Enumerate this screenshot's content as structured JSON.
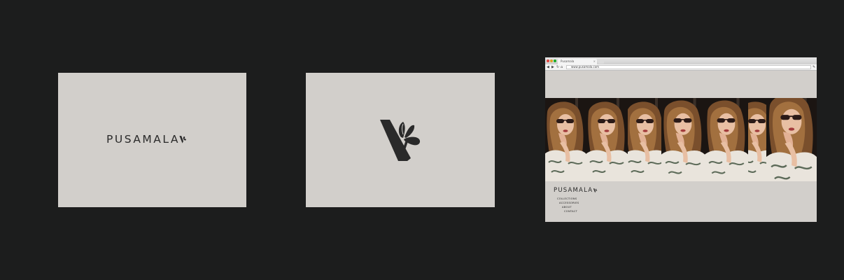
{
  "brand": {
    "wordmark": "PUSAMALA"
  },
  "colors": {
    "background": "#1c1d1d",
    "card": "#d2cfcb",
    "ink": "#2a2a2a"
  },
  "icons": [
    "v-butterfly-monogram",
    "back-arrow-icon",
    "forward-arrow-icon",
    "reload-icon",
    "home-icon",
    "wrench-icon"
  ],
  "browser": {
    "tab_title": "Pusamala",
    "tab_close": "×",
    "url": "www.pusamala.com",
    "nav": [
      {
        "label": "COLLECTIONS"
      },
      {
        "label": "ACCESSORIES"
      },
      {
        "label": "ABOUT"
      },
      {
        "label": "CONTACT"
      }
    ],
    "photo_count": 7
  }
}
